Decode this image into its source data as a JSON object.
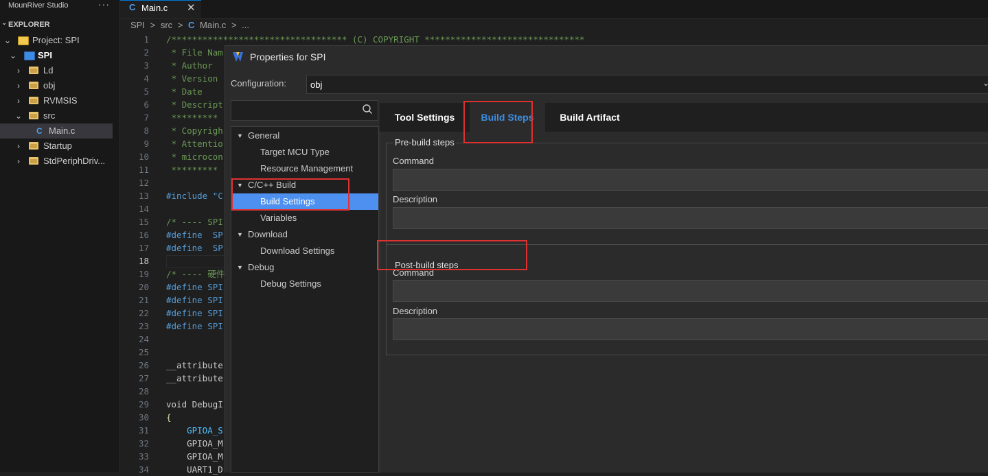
{
  "app_title": "MounRiver Studio",
  "sidebar": {
    "more_label": "···",
    "explorer_label": "EXPLORER",
    "items": [
      {
        "label": "Project: SPI",
        "icon": "project-icon"
      },
      {
        "label": "SPI",
        "icon": "project-folder-icon"
      },
      {
        "label": "Ld",
        "icon": "folder-icon"
      },
      {
        "label": "obj",
        "icon": "folder-icon"
      },
      {
        "label": "RVMSIS",
        "icon": "folder-icon"
      },
      {
        "label": "src",
        "icon": "folder-icon"
      },
      {
        "label": "Main.c",
        "icon": "c-file-icon"
      },
      {
        "label": "Startup",
        "icon": "folder-icon"
      },
      {
        "label": "StdPeriphDriv...",
        "icon": "folder-icon"
      }
    ]
  },
  "tab": {
    "icon": "C",
    "label": "Main.c",
    "close": "✕"
  },
  "breadcrumb": [
    "SPI",
    ">",
    "src",
    ">",
    "C",
    "Main.c",
    ">",
    "..."
  ],
  "editor": {
    "lines": [
      {
        "n": "1",
        "text": "/********************************** (C) COPYRIGHT *******************************",
        "cls": "cmt"
      },
      {
        "n": "2",
        "text": " * File Nam",
        "cls": "cmt"
      },
      {
        "n": "3",
        "text": " * Author",
        "cls": "cmt"
      },
      {
        "n": "4",
        "text": " * Version",
        "cls": "cmt"
      },
      {
        "n": "5",
        "text": " * Date",
        "cls": "cmt"
      },
      {
        "n": "6",
        "text": " * Descript",
        "cls": "cmt"
      },
      {
        "n": "7",
        "text": " *********",
        "cls": "cmt"
      },
      {
        "n": "8",
        "text": " * Copyrigh",
        "cls": "cmt"
      },
      {
        "n": "9",
        "text": " * Attentio",
        "cls": "cmt"
      },
      {
        "n": "10",
        "text": " * microcon",
        "cls": "cmt"
      },
      {
        "n": "11",
        "text": " *********",
        "cls": "cmt"
      },
      {
        "n": "12",
        "text": "",
        "cls": "plain"
      },
      {
        "n": "13",
        "text": "#include \"C",
        "cls": "kw"
      },
      {
        "n": "14",
        "text": "",
        "cls": "plain"
      },
      {
        "n": "15",
        "text": "/* ---- SPI",
        "cls": "cmt"
      },
      {
        "n": "16",
        "text": "#define  SP",
        "cls": "kw"
      },
      {
        "n": "17",
        "text": "#define  SP",
        "cls": "kw"
      },
      {
        "n": "18",
        "text": "",
        "cls": "plain"
      },
      {
        "n": "19",
        "text": "/* ---- 硬件",
        "cls": "cmt"
      },
      {
        "n": "20",
        "text": "#define SPI",
        "cls": "kw"
      },
      {
        "n": "21",
        "text": "#define SPI",
        "cls": "kw"
      },
      {
        "n": "22",
        "text": "#define SPI",
        "cls": "kw"
      },
      {
        "n": "23",
        "text": "#define SPI",
        "cls": "kw"
      },
      {
        "n": "24",
        "text": "",
        "cls": "plain"
      },
      {
        "n": "25",
        "text": "",
        "cls": "plain"
      },
      {
        "n": "26",
        "text": "__attribute",
        "cls": "plain"
      },
      {
        "n": "27",
        "text": "__attribute",
        "cls": "plain"
      },
      {
        "n": "28",
        "text": "",
        "cls": "plain"
      },
      {
        "n": "29",
        "text": "void DebugI",
        "cls": "plain"
      },
      {
        "n": "30",
        "text": "{",
        "cls": "id"
      },
      {
        "n": "31",
        "text": "    GPIOA_S",
        "cls": "fn-const"
      },
      {
        "n": "32",
        "text": "    GPIOA_M",
        "cls": "plain"
      },
      {
        "n": "33",
        "text": "    GPIOA_M",
        "cls": "plain"
      },
      {
        "n": "34",
        "text": "    UART1_D",
        "cls": "plain"
      }
    ]
  },
  "dialog": {
    "title": "Properties for SPI",
    "configuration_label": "Configuration:",
    "configuration_value": "obj",
    "search_placeholder": "",
    "tree": [
      {
        "label": "General",
        "level": 0,
        "expanded": true
      },
      {
        "label": "Target MCU Type",
        "level": 1
      },
      {
        "label": "Resource Management",
        "level": 1
      },
      {
        "label": "C/C++ Build",
        "level": 0,
        "expanded": true
      },
      {
        "label": "Build Settings",
        "level": 1,
        "selected": true
      },
      {
        "label": "Variables",
        "level": 1
      },
      {
        "label": "Download",
        "level": 0,
        "expanded": true
      },
      {
        "label": "Download Settings",
        "level": 1
      },
      {
        "label": "Debug",
        "level": 0,
        "expanded": true
      },
      {
        "label": "Debug Settings",
        "level": 1
      }
    ],
    "tabs": [
      {
        "label": "Tool Settings",
        "active": false
      },
      {
        "label": "Build Steps",
        "active": true
      },
      {
        "label": "Build Artifact",
        "active": false
      }
    ],
    "pre_build": {
      "legend": "Pre-build steps",
      "command_label": "Command",
      "command_value": "",
      "description_label": "Description",
      "description_value": ""
    },
    "post_build": {
      "legend": "Post-build steps",
      "command_label": "Command",
      "command_value": "",
      "description_label": "Description",
      "description_value": ""
    }
  },
  "colors": {
    "accent_blue": "#3e8ee0",
    "selection_blue": "#4d90f0",
    "highlight_red": "#e03131",
    "background": "#1f1f1f"
  }
}
